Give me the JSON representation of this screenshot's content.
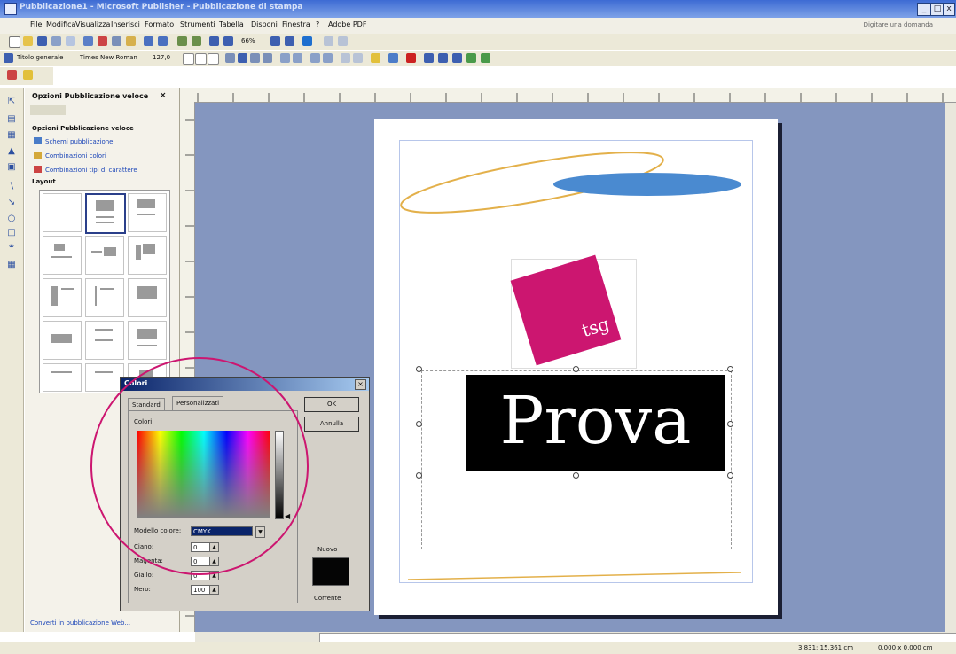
{
  "window": {
    "title": "Pubblicazione1 - Microsoft Publisher - Pubblicazione di stampa",
    "controls": [
      "_",
      "□",
      "x"
    ]
  },
  "menubar": {
    "items": [
      "File",
      "Modifica",
      "Visualizza",
      "Inserisci",
      "Formato",
      "Strumenti",
      "Tabella",
      "Disponi",
      "Finestra",
      "?",
      "Adobe PDF"
    ],
    "help_placeholder": "Digitare una domanda"
  },
  "formatting_toolbar": {
    "style": "Titolo generale",
    "font": "Times New Roman",
    "size": "127,0"
  },
  "standard_toolbar": {
    "zoom": "66%"
  },
  "task_pane": {
    "title": "Opzioni Pubblicazione veloce",
    "heading": "Opzioni Pubblicazione veloce",
    "links": [
      "Schemi pubblicazione",
      "Combinazioni colori",
      "Combinazioni tipi di carattere"
    ],
    "layout_label": "Layout",
    "footer_link": "Converti in pubblicazione Web..."
  },
  "document": {
    "headline": "Prova",
    "logo_text": "tsg",
    "colors": {
      "logo": "#cc1670",
      "ellipse": "#4a8ad0",
      "workspace": "#8496bf"
    }
  },
  "color_dialog": {
    "title": "Colori",
    "tabs": [
      "Standard",
      "Personalizzati"
    ],
    "active_tab": "Personalizzati",
    "colors_label": "Colori:",
    "model_label": "Modello colore:",
    "model_value": "CMYK",
    "fields": [
      {
        "label": "Ciano:",
        "value": "0"
      },
      {
        "label": "Magenta:",
        "value": "0"
      },
      {
        "label": "Giallo:",
        "value": "0"
      },
      {
        "label": "Nero:",
        "value": "100"
      }
    ],
    "ok": "OK",
    "cancel": "Annulla",
    "new_label": "Nuovo",
    "current_label": "Corrente"
  },
  "status": {
    "position": "3,831; 15,361 cm",
    "size": "0,000 x 0,000 cm"
  }
}
